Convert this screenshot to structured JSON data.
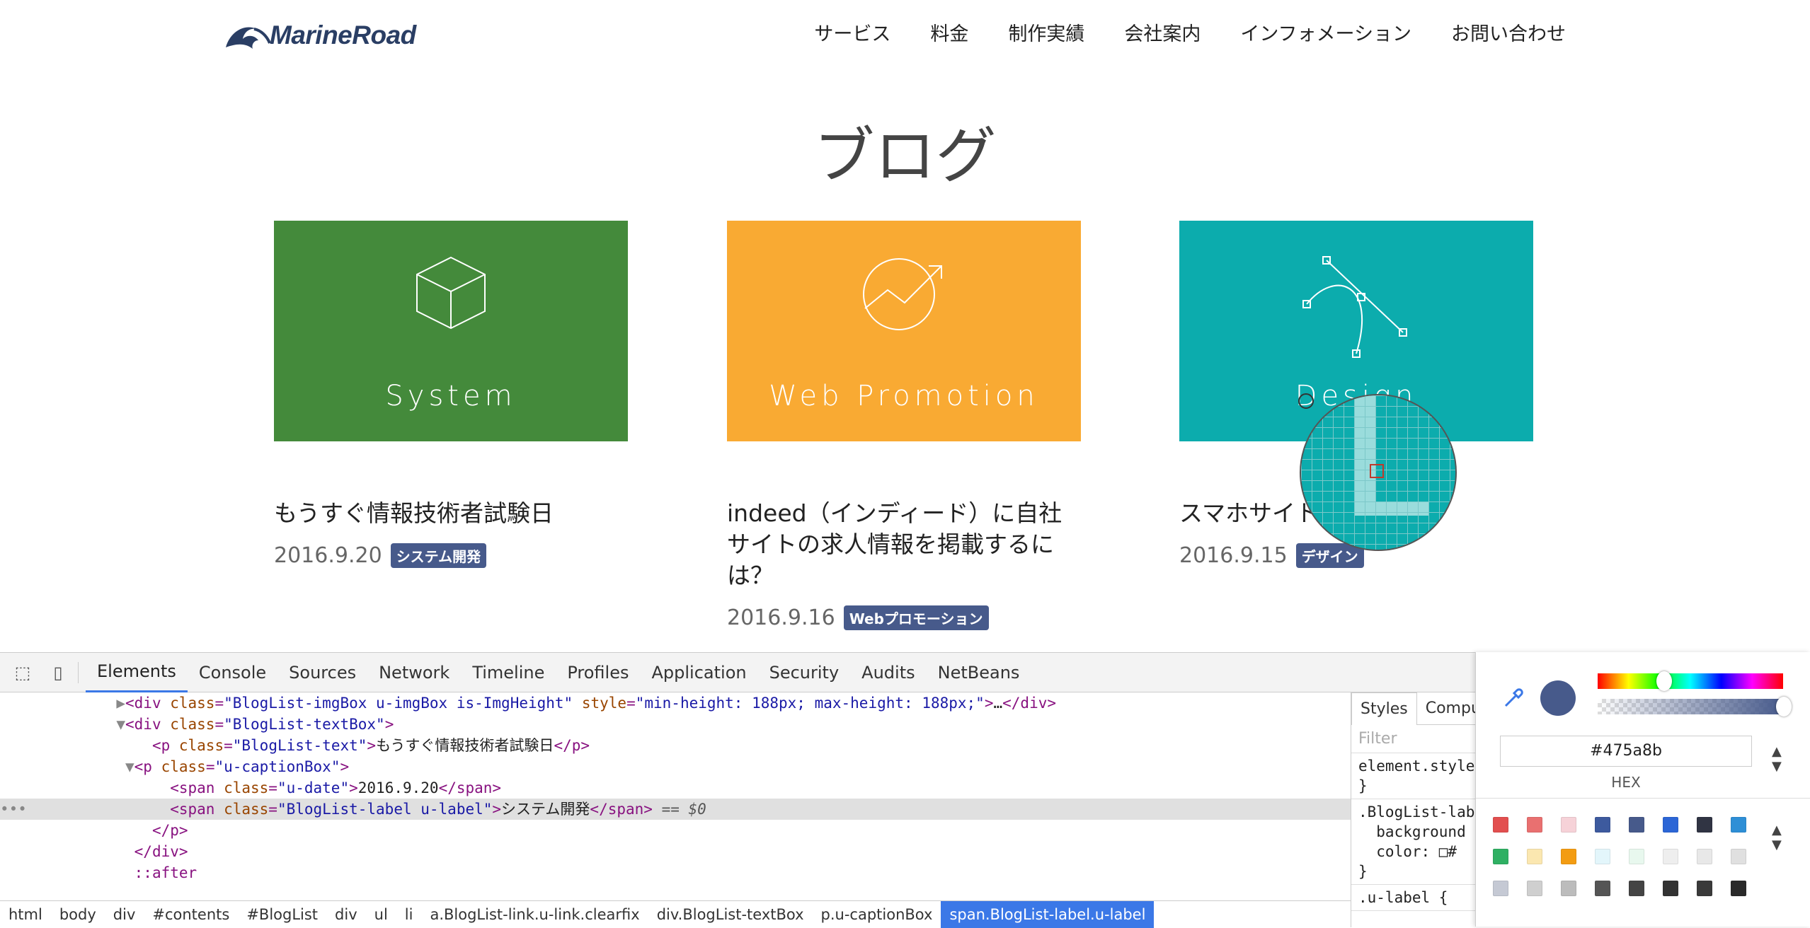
{
  "site": {
    "logo_text": "MarineRoad",
    "nav": [
      "サービス",
      "料金",
      "制作実績",
      "会社案内",
      "インフォメーション",
      "お問い合わせ"
    ],
    "page_title": "ブログ"
  },
  "cards": [
    {
      "category": "System",
      "title": "もうすぐ情報技術者試験日",
      "date": "2016.9.20",
      "label": "システム開発",
      "color": "#448a3b",
      "icon": "cube-icon"
    },
    {
      "category": "Web Promotion",
      "title": "indeed（インディード）に自社サイトの求人情報を掲載するには？",
      "date": "2016.9.16",
      "label": "Webプロモーション",
      "color": "#f9aa33",
      "icon": "trend-chart-icon"
    },
    {
      "category": "Design",
      "title": "スマホサイト便利ツール",
      "date": "2016.9.15",
      "label": "デザイン",
      "color": "#0cacad",
      "icon": "bezier-curve-icon"
    }
  ],
  "devtools": {
    "tabs": [
      "Elements",
      "Console",
      "Sources",
      "Network",
      "Timeline",
      "Profiles",
      "Application",
      "Security",
      "Audits",
      "NetBeans"
    ],
    "active_tab": "Elements",
    "lines": [
      {
        "indent": "          ",
        "arrow": "▶",
        "html": "<div class=\"BlogList-imgBox u-imgBox is-ImgHeight\" style=\"min-height: 188px; max-height: 188px;\">…</div>"
      },
      {
        "indent": "          ",
        "arrow": "▼",
        "html": "<div class=\"BlogList-textBox\">"
      },
      {
        "indent": "             ",
        "arrow": "",
        "html": "<p class=\"BlogList-text\">もうすぐ情報技術者試験日</p>"
      },
      {
        "indent": "           ",
        "arrow": "▼",
        "html": "<p class=\"u-captionBox\">"
      },
      {
        "indent": "               ",
        "arrow": "",
        "html": "<span class=\"u-date\">2016.9.20</span>"
      },
      {
        "indent": "               ",
        "arrow": "",
        "html": "<span class=\"BlogList-label u-label\">システム開発</span> == $0"
      },
      {
        "indent": "             ",
        "arrow": "",
        "html": "</p>"
      },
      {
        "indent": "           ",
        "arrow": "",
        "html": "</div>"
      },
      {
        "indent": "           ",
        "arrow": "",
        "html": "::after"
      }
    ],
    "breadcrumbs": [
      "html",
      "body",
      "div",
      "#contents",
      "#BlogList",
      "div",
      "ul",
      "li",
      "a.BlogList-link.u-link.clearfix",
      "div.BlogList-textBox",
      "p.u-captionBox",
      "span.BlogList-label.u-label"
    ],
    "styles_tabs": [
      "Styles",
      "Compu"
    ],
    "filter_placeholder": "Filter",
    "rules": [
      "element.style\n}",
      ".BlogList-lab\n  background\n  color: □#\n}",
      ".u-label {"
    ]
  },
  "color_picker": {
    "hex": "#475a8b",
    "mode_label": "HEX",
    "current_color": "#475a8b",
    "palette": [
      [
        "#e24f4f",
        "#e97070",
        "#f6d2d8",
        "#3d5a9e",
        "#475a8b",
        "#2c66d6",
        "#303443",
        "#2e8fd6"
      ],
      [
        "#2fb063",
        "#fbe7b0",
        "#f39c12",
        "#e3f6fb",
        "#e8f8ee",
        "#eeeeee",
        "#e8e8e8",
        "#e0e0e0"
      ],
      [
        "#c5c9d4",
        "#cfcfcf",
        "#bcbcbc",
        "#555555",
        "#444444",
        "#333333",
        "#3a3a3a",
        "#2a2a2a"
      ]
    ]
  }
}
